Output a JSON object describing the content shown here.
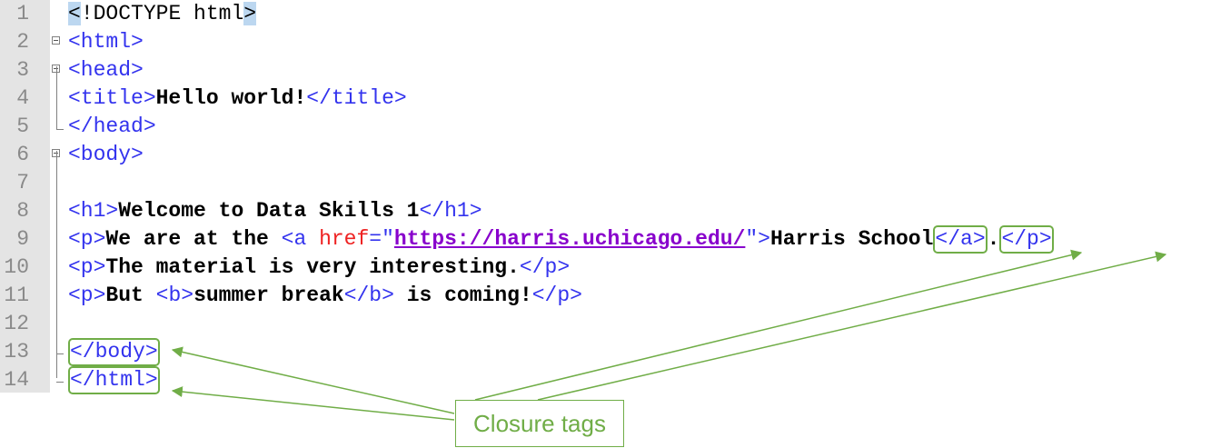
{
  "editor": {
    "line_numbers": [
      "1",
      "2",
      "3",
      "4",
      "5",
      "6",
      "7",
      "8",
      "9",
      "10",
      "11",
      "12",
      "13",
      "14"
    ],
    "lines": {
      "l1": {
        "lt": "<",
        "bang": "!",
        "rest": "DOCTYPE html",
        "gt": ">"
      },
      "l2": {
        "tag": "<html>"
      },
      "l3": {
        "tag": "<head>"
      },
      "l4": {
        "open": "<title>",
        "text": "Hello world!",
        "close": "</title>"
      },
      "l5": {
        "tag": "</head>"
      },
      "l6": {
        "tag": "<body>"
      },
      "l8": {
        "open": "<h1>",
        "text": "Welcome to Data Skills 1",
        "close": "</h1>"
      },
      "l9": {
        "open_p": "<p>",
        "text1": "We are at the ",
        "open_a": "<a ",
        "attr": "href",
        "eq": "=\"",
        "url": "https://harris.uchicago.edu/",
        "q_close": "\">",
        "link_text": "Harris School",
        "close_a": "</a>",
        "dot": ".",
        "close_p": "</p>"
      },
      "l10": {
        "open": "<p>",
        "text": "The material is very interesting.",
        "close": "</p>"
      },
      "l11": {
        "open": "<p>",
        "text1": "But ",
        "open_b": "<b>",
        "btext": "summer break",
        "close_b": "</b>",
        "text2": " is coming!",
        "close": "</p>"
      },
      "l13": {
        "tag": "</body>"
      },
      "l14": {
        "tag": "</html>"
      }
    }
  },
  "annotation": {
    "label": "Closure tags",
    "color": "#70ad47"
  }
}
